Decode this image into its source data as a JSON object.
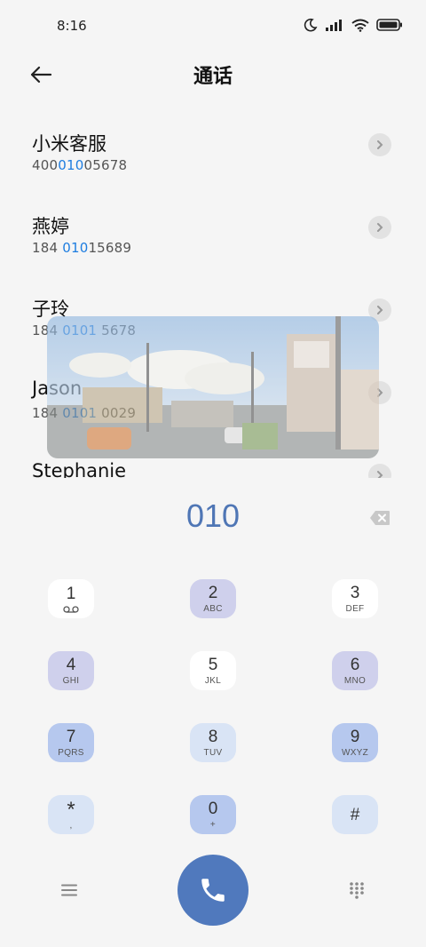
{
  "status_bar": {
    "time": "8:16"
  },
  "header": {
    "title": "通话"
  },
  "contacts": [
    {
      "name": "小米客服",
      "number_parts": [
        "400",
        "010",
        "05678"
      ]
    },
    {
      "name": "燕婷",
      "number_parts": [
        "184 ",
        "010",
        "15689"
      ]
    },
    {
      "name": "子玲",
      "number_parts": [
        "184 ",
        "0101",
        " 5678"
      ]
    },
    {
      "name": "Jason",
      "number_parts": [
        "184 ",
        "0101",
        " 0029"
      ]
    },
    {
      "name": "Stephanie",
      "number_parts": [
        "",
        "",
        ""
      ]
    }
  ],
  "dialed": "010",
  "keys": [
    {
      "digit": "1",
      "letters": ""
    },
    {
      "digit": "2",
      "letters": "ABC"
    },
    {
      "digit": "3",
      "letters": "DEF"
    },
    {
      "digit": "4",
      "letters": "GHI"
    },
    {
      "digit": "5",
      "letters": "JKL"
    },
    {
      "digit": "6",
      "letters": "MNO"
    },
    {
      "digit": "7",
      "letters": "PQRS"
    },
    {
      "digit": "8",
      "letters": "TUV"
    },
    {
      "digit": "9",
      "letters": "WXYZ"
    },
    {
      "digit": "*",
      "letters": ","
    },
    {
      "digit": "0",
      "letters": "+"
    },
    {
      "digit": "#",
      "letters": ""
    }
  ],
  "key_colors": {
    "white": "#ffffff",
    "lavender": "#cfd0ec",
    "blue": "#b6c8ee",
    "pale_blue": "#d9e4f5",
    "call": "#5079bd",
    "highlight": "#1e7de0"
  },
  "icons": [
    "back-arrow-icon",
    "moon-icon",
    "signal-icon",
    "wifi-icon",
    "battery-icon",
    "chevron-right-icon",
    "backspace-icon",
    "voicemail-icon",
    "menu-icon",
    "phone-icon",
    "dialpad-icon"
  ]
}
